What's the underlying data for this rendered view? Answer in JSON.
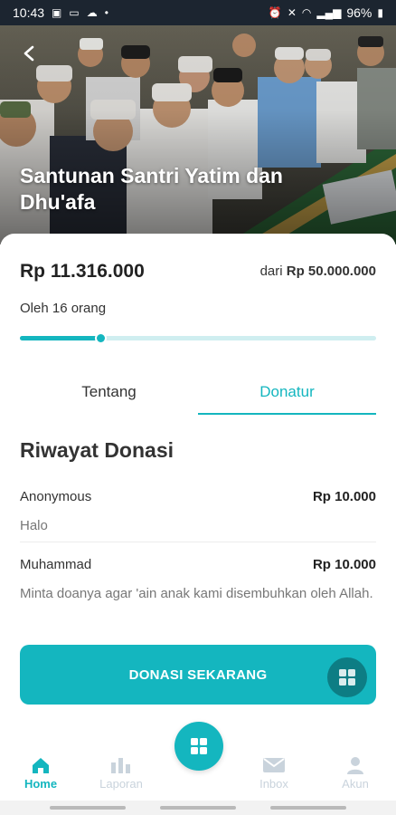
{
  "status_bar": {
    "time": "10:43",
    "battery": "96%"
  },
  "campaign": {
    "title": "Santunan Santri Yatim dan Dhu'afa",
    "collected": "Rp 11.316.000",
    "target_prefix": "dari",
    "target_amount": "Rp 50.000.000",
    "donors_text": "Oleh 16 orang",
    "progress_fraction": 0.226
  },
  "tabs": [
    {
      "label": "Tentang",
      "active": false
    },
    {
      "label": "Donatur",
      "active": true
    }
  ],
  "history": {
    "title": "Riwayat Donasi",
    "items": [
      {
        "name": "Anonymous",
        "amount": "Rp 10.000",
        "message": "Halo"
      },
      {
        "name": "Muhammad",
        "amount": "Rp 10.000",
        "message": "Minta doanya agar 'ain anak kami disembuhkan oleh Allah."
      }
    ]
  },
  "donate_button": "DONASI SEKARANG",
  "bottom_nav": [
    {
      "label": "Home",
      "icon": "home-icon",
      "active": true
    },
    {
      "label": "Laporan",
      "icon": "chart-icon",
      "active": false
    },
    {
      "label": "Inbox",
      "icon": "mail-icon",
      "active": false
    },
    {
      "label": "Akun",
      "icon": "user-icon",
      "active": false
    }
  ],
  "colors": {
    "accent": "#14b6bf",
    "accent_dark": "#0d7d84",
    "nav_inactive": "#c9d3dc"
  }
}
